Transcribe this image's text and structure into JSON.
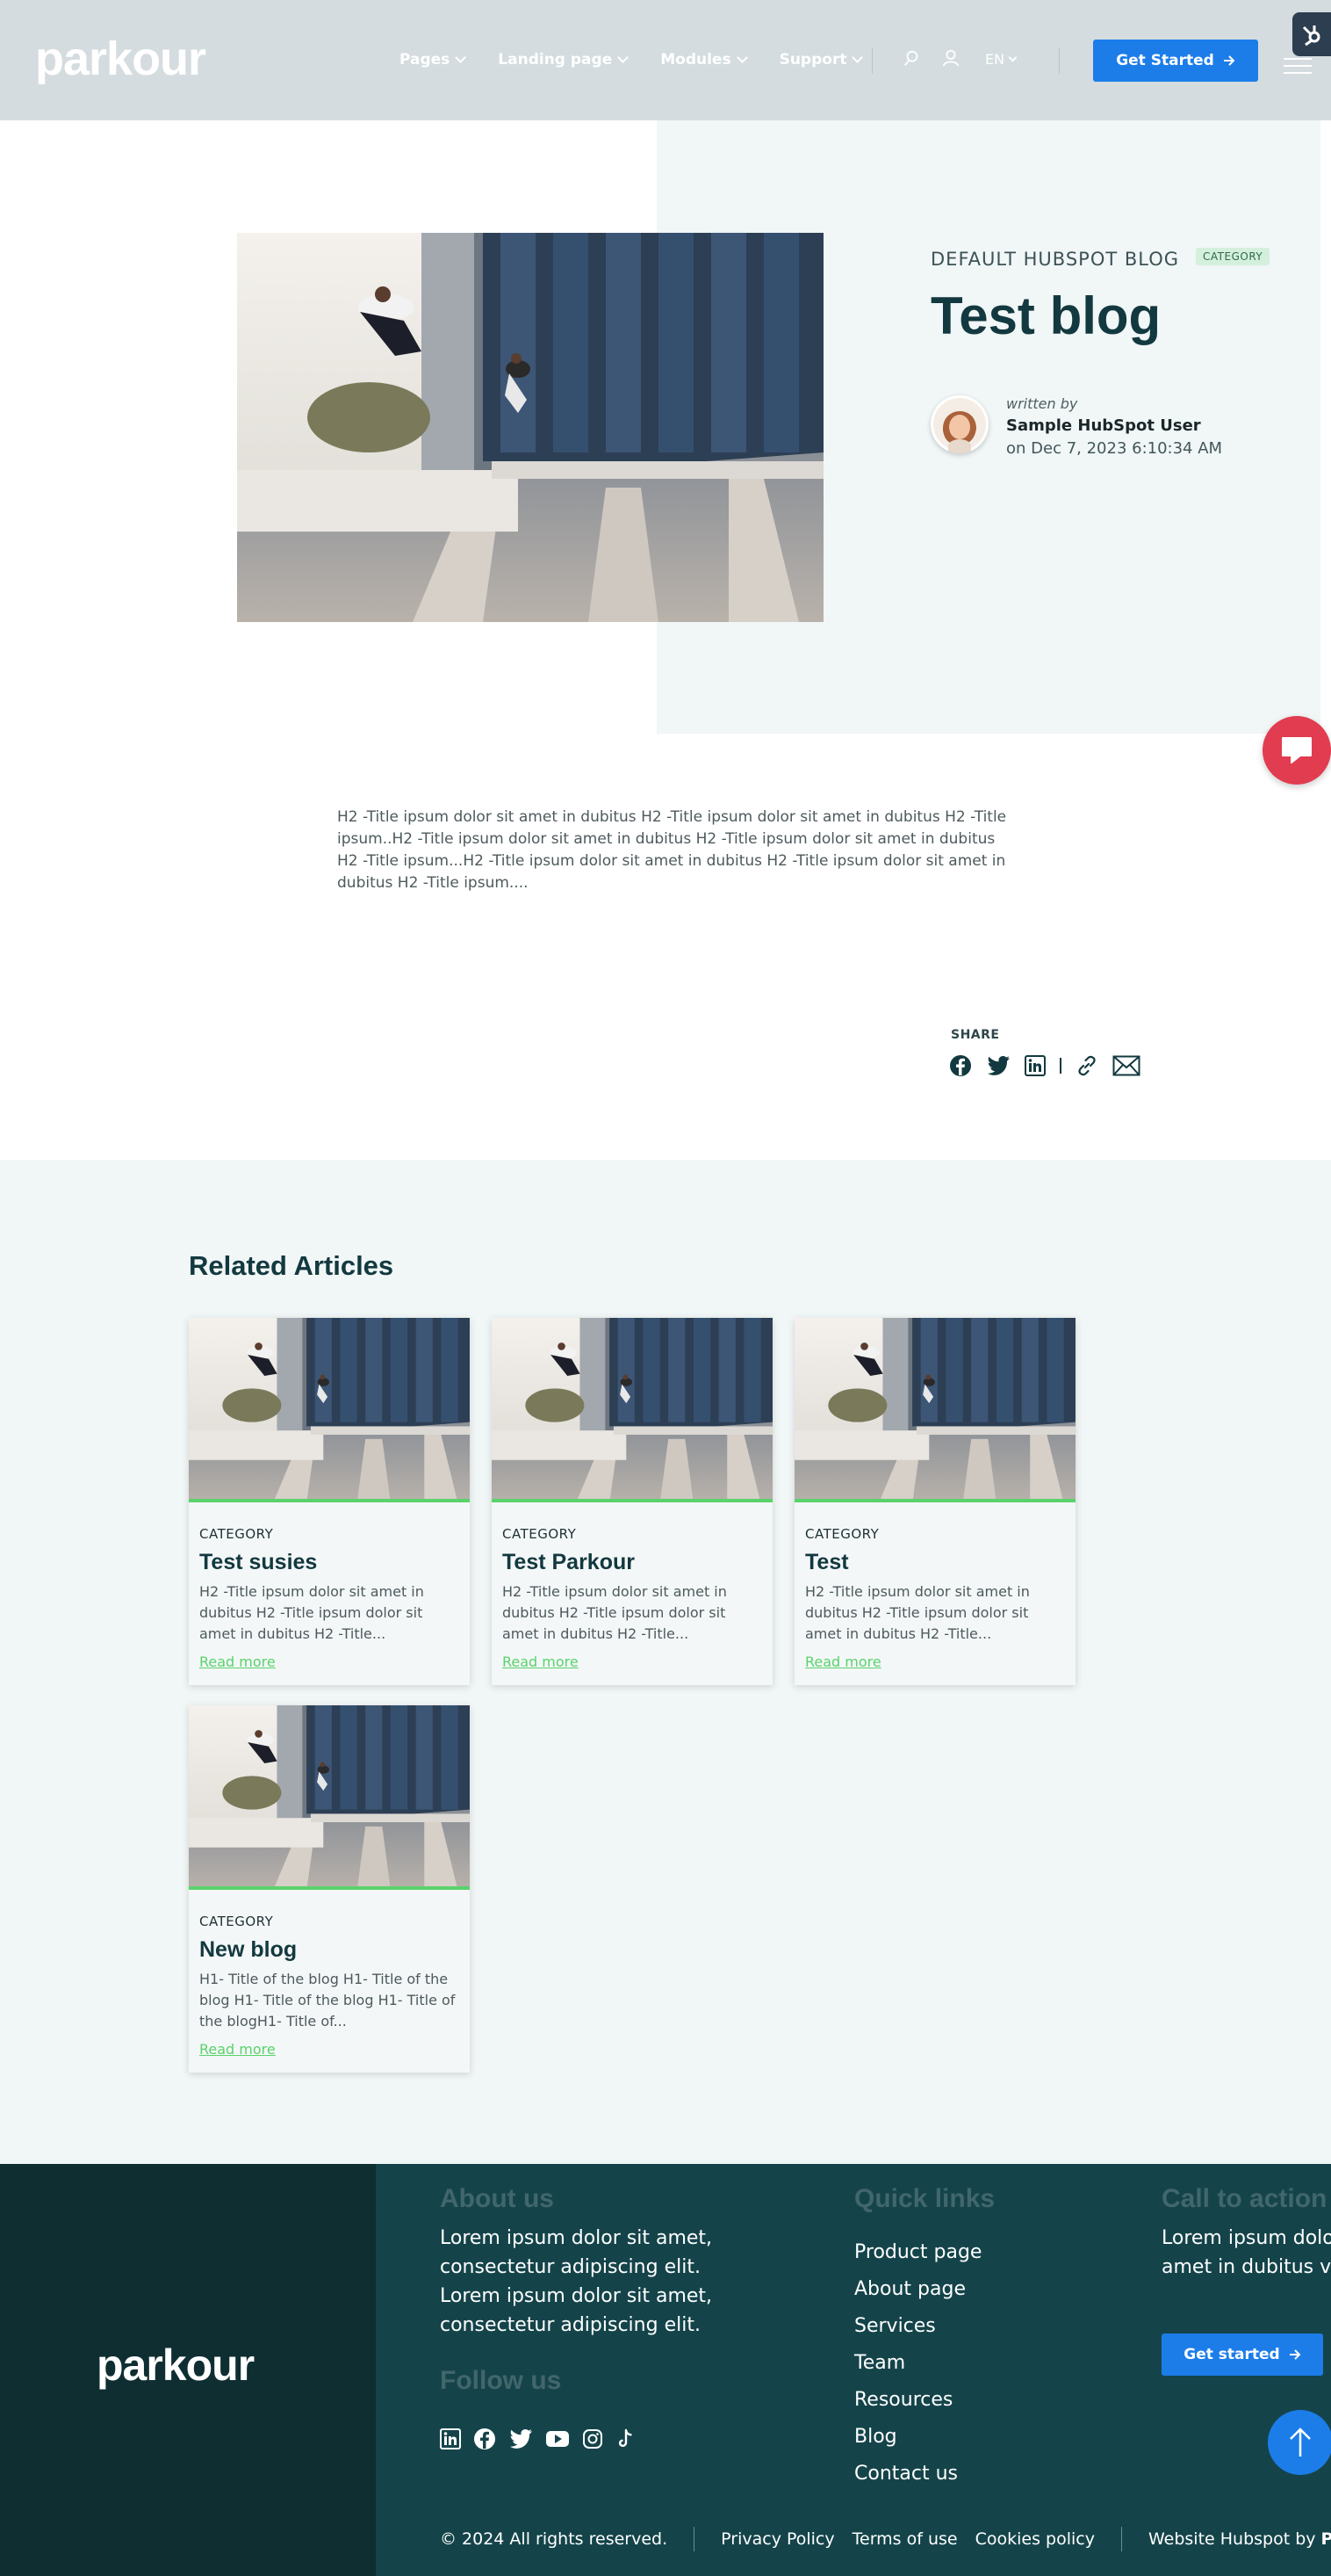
{
  "header": {
    "logo": "parkour",
    "nav": [
      {
        "label": "Pages"
      },
      {
        "label": "Landing page"
      },
      {
        "label": "Modules"
      },
      {
        "label": "Support"
      }
    ],
    "lang": "EN",
    "cta": "Get Started",
    "icons": [
      "search-icon",
      "user-icon",
      "menu-icon",
      "hubspot-sprocket-icon"
    ]
  },
  "post": {
    "blog_name": "DEFAULT HUBSPOT BLOG",
    "category": "CATEGORY",
    "title": "Test blog",
    "written_by": "written by",
    "author": "Sample HubSpot User",
    "date": "on Dec 7, 2023 6:10:34 AM",
    "body": "H2 -Title ipsum dolor sit amet in dubitus H2 -Title ipsum dolor sit amet in dubitus H2 -Title ipsum..H2 -Title ipsum dolor sit amet in dubitus H2 -Title ipsum dolor sit amet in dubitus H2 -Title ipsum...H2 -Title ipsum dolor sit amet in dubitus H2 -Title ipsum dolor sit amet in dubitus H2 -Title ipsum....",
    "share_label": "SHARE",
    "share_icons": [
      "facebook-icon",
      "twitter-icon",
      "linkedin-icon",
      "link-icon",
      "email-icon"
    ]
  },
  "related": {
    "title": "Related Articles",
    "cards": [
      {
        "category": "CATEGORY",
        "title": "Test susies",
        "excerpt": "H2 -Title ipsum dolor sit amet in dubitus H2 -Title ipsum dolor sit amet in dubitus H2 -Title...",
        "link": "Read more"
      },
      {
        "category": "CATEGORY",
        "title": "Test Parkour",
        "excerpt": "H2 -Title ipsum dolor sit amet in dubitus H2 -Title ipsum dolor sit amet in dubitus H2 -Title...",
        "link": "Read more"
      },
      {
        "category": "CATEGORY",
        "title": "Test",
        "excerpt": "H2 -Title ipsum dolor sit amet in dubitus H2 -Title ipsum dolor sit amet in dubitus H2 -Title...",
        "link": "Read more"
      },
      {
        "category": "CATEGORY",
        "title": "New blog",
        "excerpt": "H1- Title of the blog H1- Title of the blog H1- Title of the blog H1- Title of the blogH1- Title of...",
        "link": "Read more"
      }
    ]
  },
  "footer": {
    "logo": "parkour",
    "about_title": "About us",
    "about_text": "Lorem ipsum dolor sit amet, consectetur adipiscing elit. Lorem ipsum dolor sit amet, consectetur adipiscing elit.",
    "follow_title": "Follow us",
    "social_icons": [
      "linkedin-icon",
      "facebook-icon",
      "twitter-icon",
      "youtube-icon",
      "instagram-icon",
      "tiktok-icon"
    ],
    "quick_title": "Quick links",
    "quick_links": [
      "Product page",
      "About page",
      "Services",
      "Team",
      "Resources",
      "Blog",
      "Contact us"
    ],
    "cta_title": "Call to action",
    "cta_text": "Lorem ipsum dolor sit amet in dubitus veritas",
    "cta_button": "Get started",
    "copyright": "© 2024 All rights reserved.",
    "privacy": "Privacy Policy",
    "terms": "Terms of use",
    "cookies": "Cookies policy",
    "credit_prefix": "Website Hubspot by",
    "credit_brand": "Parkour"
  },
  "colors": {
    "accent": "#1c7de9",
    "brand_dark": "#12393f",
    "link_green": "#59d36b",
    "chat": "#e13c4f"
  }
}
